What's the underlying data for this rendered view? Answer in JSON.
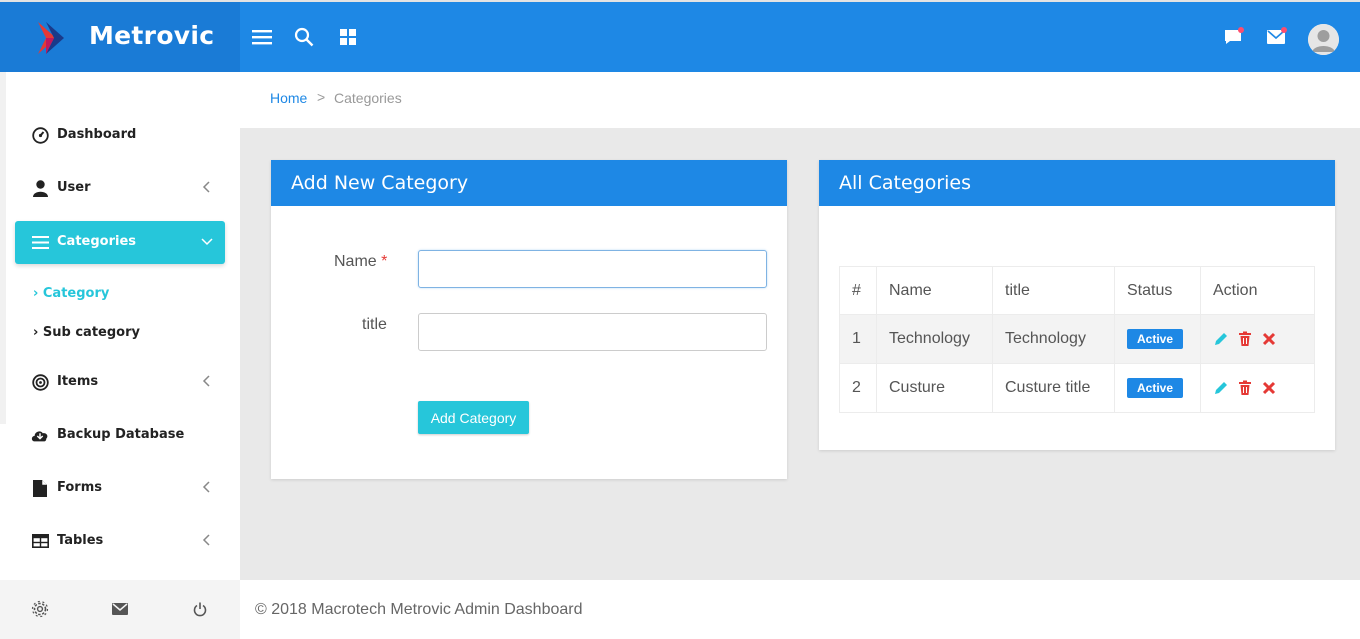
{
  "brand": {
    "name": "Metrovic"
  },
  "colors": {
    "primary": "#1e88e5",
    "accent": "#26c6da",
    "danger": "#e53935"
  },
  "topbar": {
    "icons": [
      "menu-icon",
      "search-icon",
      "grid-icon",
      "chat-icon",
      "mail-icon",
      "avatar"
    ]
  },
  "sidebar": {
    "items": [
      {
        "label": "Dashboard",
        "icon": "dashboard-icon"
      },
      {
        "label": "User",
        "icon": "user-icon"
      },
      {
        "label": "Categories",
        "icon": "list-icon",
        "active": true
      },
      {
        "label": "Items",
        "icon": "target-icon"
      },
      {
        "label": "Backup Database",
        "icon": "cloud-download-icon"
      },
      {
        "label": "Forms",
        "icon": "file-icon"
      },
      {
        "label": "Tables",
        "icon": "table-icon"
      }
    ],
    "subitems": [
      {
        "label": "Category",
        "active": true
      },
      {
        "label": "Sub category"
      }
    ],
    "footer_icons": [
      "gear-icon",
      "mail-icon",
      "power-icon"
    ]
  },
  "breadcrumb": {
    "home": "Home",
    "separator": ">",
    "current": "Categories"
  },
  "add_form": {
    "title": "Add New Category",
    "name_label": "Name",
    "required_mark": "*",
    "title_label": "title",
    "name_value": "",
    "title_value": "",
    "submit_label": "Add Category"
  },
  "all_categories": {
    "title": "All Categories",
    "columns": [
      "#",
      "Name",
      "title",
      "Status",
      "Action"
    ],
    "rows": [
      {
        "id": "1",
        "name": "Technology",
        "title": "Technology",
        "status": "Active"
      },
      {
        "id": "2",
        "name": "Custure",
        "title": "Custure title",
        "status": "Active"
      }
    ]
  },
  "footer": {
    "text": "© 2018 Macrotech Metrovic Admin Dashboard"
  }
}
